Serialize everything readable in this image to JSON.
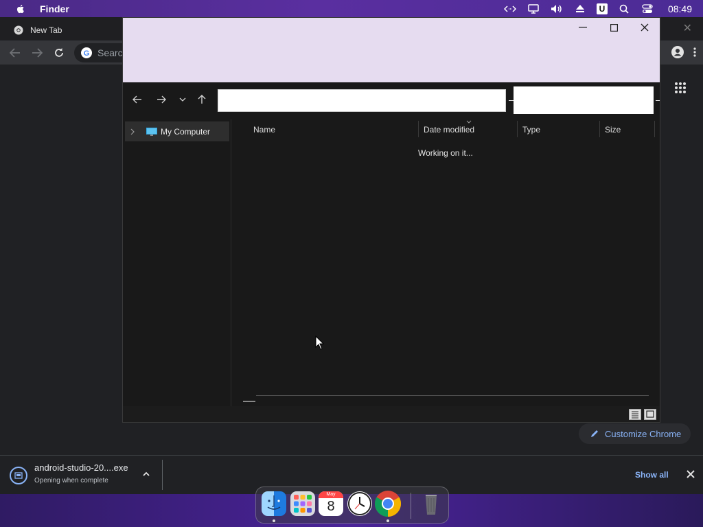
{
  "menubar": {
    "app_name": "Finder",
    "clock": "08:49",
    "u_badge": "U",
    "icons": [
      "apple-icon",
      "code-icon",
      "display-icon",
      "volume-icon",
      "eject-icon",
      "u-icon",
      "search-icon",
      "control-center-icon"
    ]
  },
  "chrome": {
    "tab_title": "New Tab",
    "omnibox_placeholder": "Search",
    "customize_label": "Customize Chrome",
    "accent": "#8ab4f8"
  },
  "download": {
    "file_name": "android-studio-20....exe",
    "status": "Opening when complete",
    "show_all": "Show all"
  },
  "dialog": {
    "address_value": "",
    "search_value": "",
    "sidebar": {
      "items": [
        {
          "label": "My Computer"
        }
      ]
    },
    "columns": {
      "name": "Name",
      "date_modified": "Date modified",
      "type": "Type",
      "size": "Size"
    },
    "loading_text": "Working on it...",
    "title_bar_color": "#e6dcf0"
  },
  "dock": {
    "apps": [
      "finder-icon",
      "launchpad-icon",
      "calendar-icon",
      "clock-icon",
      "chrome-icon",
      "trash-icon"
    ],
    "calendar": {
      "month": "May",
      "day": "8"
    }
  }
}
